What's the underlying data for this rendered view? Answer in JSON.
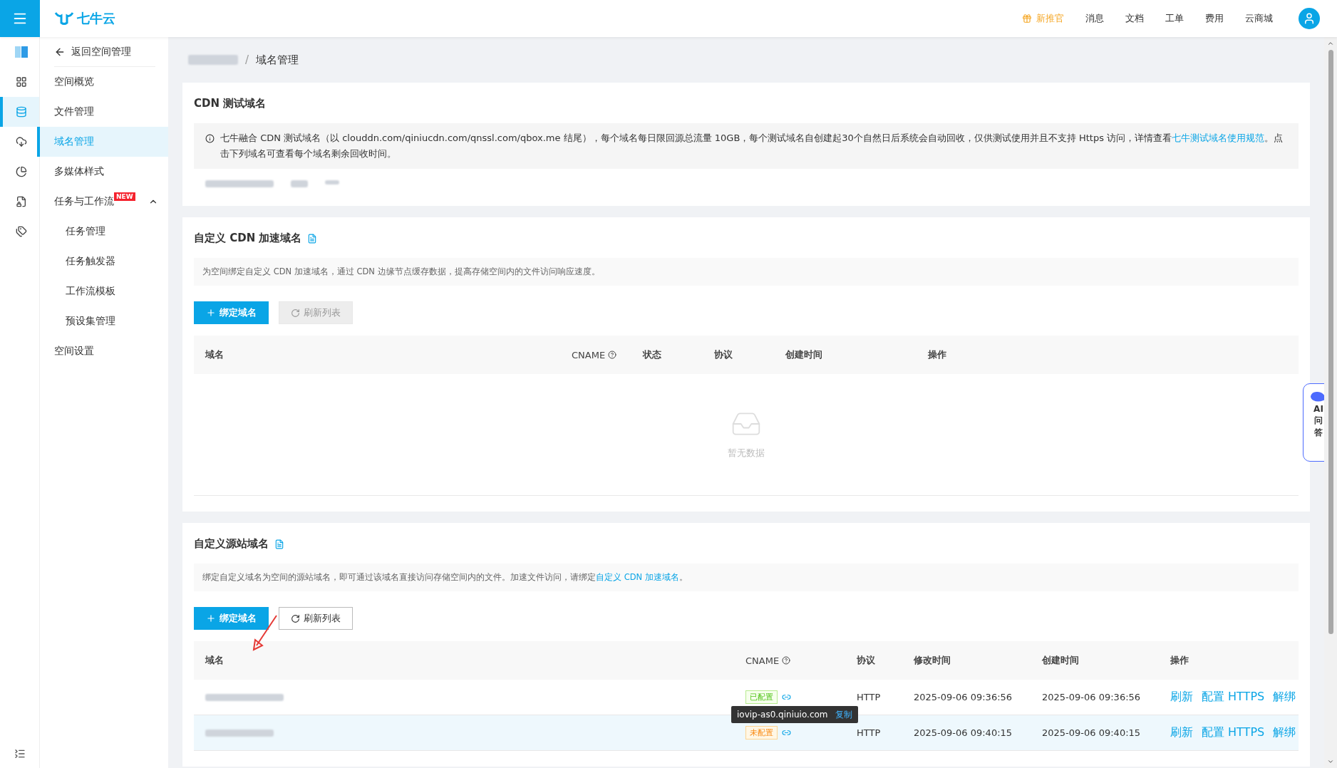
{
  "topbar": {
    "logo_text": "七牛云",
    "nav": [
      {
        "label": "新推官",
        "kind": "promo"
      },
      {
        "label": "消息",
        "kind": "plain"
      },
      {
        "label": "文档",
        "kind": "plain"
      },
      {
        "label": "工单",
        "kind": "plain"
      },
      {
        "label": "费用",
        "kind": "plain"
      },
      {
        "label": "云商城",
        "kind": "plain"
      }
    ]
  },
  "icon_rail": [
    {
      "kind": "space",
      "selected": false
    },
    {
      "kind": "grid",
      "selected": false
    },
    {
      "kind": "database",
      "selected": true
    },
    {
      "kind": "cloud",
      "selected": false
    },
    {
      "kind": "pie",
      "selected": false
    },
    {
      "kind": "shield",
      "selected": false
    },
    {
      "kind": "tag",
      "selected": false
    }
  ],
  "sidebar": {
    "back_label": "返回空间管理",
    "items": [
      {
        "label": "空间概览",
        "selected": false
      },
      {
        "label": "文件管理",
        "selected": false
      },
      {
        "label": "域名管理",
        "selected": true
      },
      {
        "label": "多媒体样式",
        "selected": false
      },
      {
        "label": "任务与工作流",
        "selected": false,
        "badge": "NEW",
        "expanded": true,
        "children": [
          {
            "label": "任务管理",
            "selected": false
          },
          {
            "label": "任务触发器",
            "selected": false
          },
          {
            "label": "工作流模板",
            "selected": false
          },
          {
            "label": "预设集管理",
            "selected": false
          }
        ]
      },
      {
        "label": "空间设置",
        "selected": false
      }
    ]
  },
  "breadcrumb": {
    "separator": "/",
    "current": "域名管理"
  },
  "test_section": {
    "title": "CDN 测试域名",
    "notice": "七牛融合 CDN 测试域名（以 clouddn.com/qiniucdn.com/qnssl.com/qbox.me 结尾），每个域名每日限回源总流量 10GB，每个测试域名自创建起30个自然日后系统会自动回收，仅供测试使用并且不支持 Https 访问，详情查看",
    "notice_link": "七牛测试域名使用规范",
    "notice_tail": "。点击下列域名可查看每个域名剩余回收时间。"
  },
  "cdn_section": {
    "title": "自定义 CDN 加速域名",
    "description": "为空间绑定自定义 CDN 加速域名，通过 CDN 边缘节点缓存数据，提高存储空间内的文件访问响应速度。",
    "buttons": [
      {
        "label": "绑定域名",
        "kind": "primary"
      },
      {
        "label": "刷新列表",
        "kind": "refresh",
        "disabled": true
      }
    ],
    "columns": [
      "域名",
      "CNAME",
      "状态",
      "协议",
      "创建时间",
      "操作"
    ],
    "empty_text": "暂无数据"
  },
  "origin_section": {
    "title": "自定义源站域名",
    "description": "绑定自定义域名为空间的源站域名，即可通过该域名直接访问存储空间内的文件。加速文件访问，请绑定",
    "description_link": "自定义 CDN 加速域名",
    "description_tail": "。",
    "buttons": [
      {
        "label": "绑定域名",
        "kind": "primary"
      },
      {
        "label": "刷新列表",
        "kind": "refresh",
        "disabled": false
      }
    ],
    "columns": [
      "域名",
      "CNAME",
      "协议",
      "修改时间",
      "创建时间",
      "操作"
    ],
    "rows": [
      {
        "cname_status": "已配置",
        "configured": true,
        "protocol": "HTTP",
        "modified": "2025-09-06 09:36:56",
        "created": "2025-09-06 09:36:56",
        "actions": [
          "刷新",
          "配置 HTTPS",
          "解绑"
        ],
        "highlighted": false
      },
      {
        "cname_status": "未配置",
        "configured": false,
        "protocol": "HTTP",
        "modified": "2025-09-06 09:40:15",
        "created": "2025-09-06 09:40:15",
        "actions": [
          "刷新",
          "配置 HTTPS",
          "解绑"
        ],
        "highlighted": true
      }
    ],
    "tooltip": {
      "text": "iovip-as0.qiniuio.com",
      "action": "复制"
    }
  },
  "ai_button": {
    "lines": [
      "AI",
      "问",
      "答"
    ]
  }
}
